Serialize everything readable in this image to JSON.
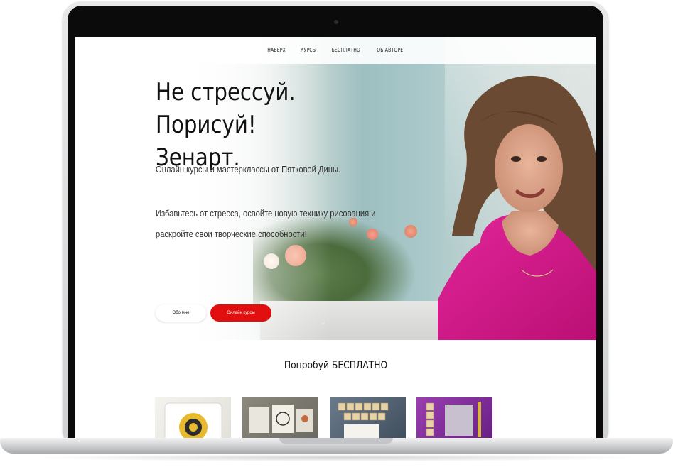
{
  "nav": {
    "items": [
      {
        "label": "НАВЕРХ"
      },
      {
        "label": "КУРСЫ"
      },
      {
        "label": "БЕСПЛАТНО"
      },
      {
        "label": "ОБ АВТОРЕ"
      }
    ]
  },
  "hero": {
    "title_line1": "Не стрессуй. Порисуй!",
    "title_line2": "Зенарт.",
    "subtitle": "Онлайн курсы и мастерклассы от Пятковой Дины.",
    "paragraph_line1": "Избавьтесь от стресса, освойте новую технику рисования и",
    "paragraph_line2": "раскройте свои творческие способности!",
    "about_button": "Обо мне",
    "courses_button": "Онлайн курсы"
  },
  "free_section": {
    "title": "Попробуй БЕСПЛАТНО"
  },
  "colors": {
    "accent": "#e10f0f",
    "dress": "#d81a8c"
  },
  "icons": {
    "scroll_down": "chevron-down-icon"
  }
}
